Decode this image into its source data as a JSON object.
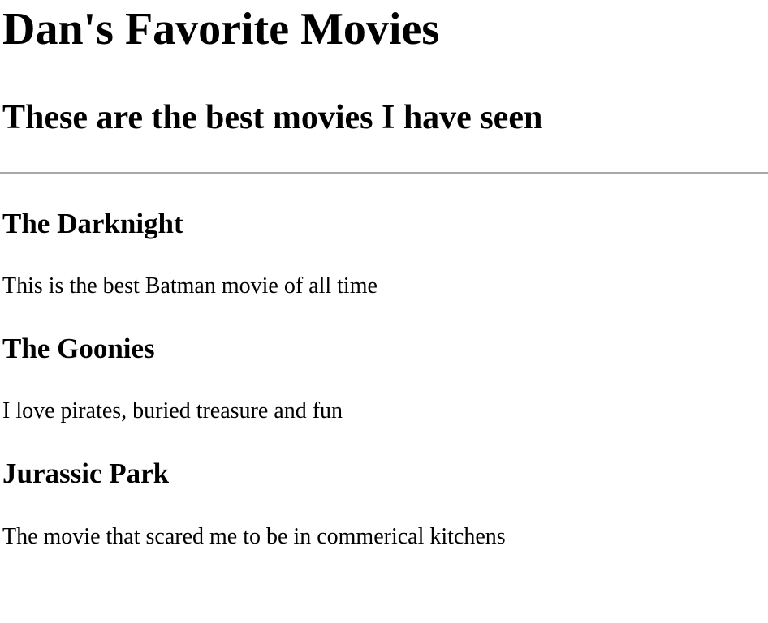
{
  "page": {
    "title": "Dan's Favorite Movies",
    "subtitle": "These are the best movies I have seen"
  },
  "movies": [
    {
      "title": "The Darknight",
      "description": "This is the best Batman movie of all time"
    },
    {
      "title": "The Goonies",
      "description": "I love pirates, buried treasure and fun"
    },
    {
      "title": "Jurassic Park",
      "description": "The movie that scared me to be in commerical kitchens"
    }
  ],
  "colors": {
    "text": "#000000",
    "background": "#ffffff",
    "divider": "#a8a8a8"
  }
}
